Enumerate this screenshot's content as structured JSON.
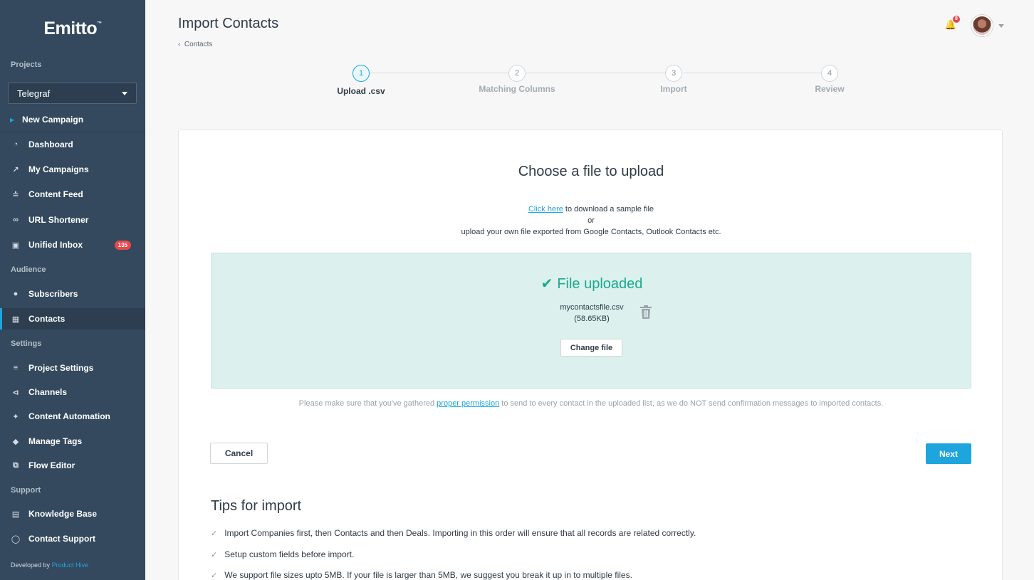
{
  "app": {
    "logo": "Emitto",
    "logo_tm": "™"
  },
  "sidebar": {
    "projects_label": "Projects",
    "project_selected": "Telegraf",
    "new_campaign": "New Campaign",
    "main_items": [
      {
        "label": "Dashboard",
        "icon": "dashboard-icon"
      },
      {
        "label": "My Campaigns",
        "icon": "chart-line-icon"
      },
      {
        "label": "Content Feed",
        "icon": "rss-icon"
      },
      {
        "label": "URL Shortener",
        "icon": "link-icon"
      },
      {
        "label": "Unified Inbox",
        "icon": "inbox-icon",
        "badge": "135"
      }
    ],
    "audience_label": "Audience",
    "audience_items": [
      {
        "label": "Subscribers",
        "icon": "users-icon"
      },
      {
        "label": "Contacts",
        "icon": "address-book-icon",
        "active": true
      }
    ],
    "settings_label": "Settings",
    "settings_items": [
      {
        "label": "Project Settings",
        "icon": "sliders-icon"
      },
      {
        "label": "Channels",
        "icon": "share-icon"
      },
      {
        "label": "Content Automation",
        "icon": "magic-wand-icon"
      },
      {
        "label": "Manage Tags",
        "icon": "tags-icon"
      },
      {
        "label": "Flow Editor",
        "icon": "flow-icon"
      }
    ],
    "support_label": "Support",
    "support_items": [
      {
        "label": "Knowledge Base",
        "icon": "book-icon"
      },
      {
        "label": "Contact Support",
        "icon": "headset-icon"
      }
    ],
    "developed_by_prefix": "Developed by",
    "developed_by_link": "Product Hive"
  },
  "header": {
    "title": "Import Contacts",
    "breadcrumb_back": "Contacts",
    "notification_count": "8"
  },
  "stepper": {
    "steps": [
      {
        "number": "1",
        "label": "Upload .csv",
        "active": true
      },
      {
        "number": "2",
        "label": "Matching Columns"
      },
      {
        "number": "3",
        "label": "Import"
      },
      {
        "number": "4",
        "label": "Review"
      }
    ]
  },
  "upload": {
    "title": "Choose a file to upload",
    "sample_link": "Click here",
    "sample_text": " to download a sample file",
    "or": "or",
    "own_file_text": "upload your own file exported from Google Contacts, Outlook Contacts etc.",
    "status": "File uploaded",
    "file_name": "mycontactsfile.csv",
    "file_size": "(58.65KB)",
    "change_file": "Change file",
    "permission_prefix": "Please make sure that you've gathered ",
    "permission_link": "proper permission",
    "permission_suffix": " to send to every contact in the uploaded list, as we do NOT send confirmation messages to imported contacts.",
    "cancel": "Cancel",
    "next": "Next"
  },
  "tips": {
    "title": "Tips for import",
    "items": [
      "Import Companies first, then Contacts and then Deals. Importing in this order will ensure that all records are related correctly.",
      "Setup custom fields before import.",
      "We support file sizes upto 5MB. If your file is larger than 5MB, we suggest you break it up in to multiple files."
    ]
  },
  "colors": {
    "sidebar": "#34495e",
    "accent": "#1ea5dd",
    "success": "#1aaa8f",
    "badge": "#e5484d"
  }
}
